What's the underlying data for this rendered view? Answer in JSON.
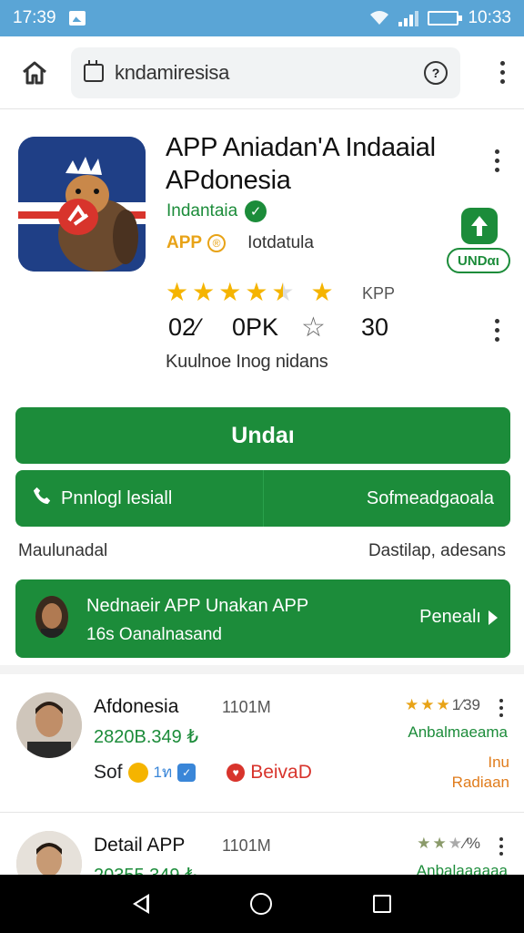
{
  "status_bar": {
    "time_left": "17:39",
    "time_right": "10:33"
  },
  "browser": {
    "url": "kndamiresisa",
    "reload_label": "?"
  },
  "app": {
    "title": "APP Aniadan'A Indaaial APdonesia",
    "developer": "Indantaia",
    "verified_glyph": "✓",
    "badge": "APP",
    "badge_symbol": "®",
    "category": "Iotdatula",
    "update_badge": "UNDαι",
    "rating_stars": 4.5,
    "rating_label": "KPP",
    "stats": [
      "02⁄",
      "0PK",
      "☆",
      "30"
    ],
    "description": "Kuulnoe Inog nidans"
  },
  "buttons": {
    "install_label": "Undaı",
    "left_action_label": "Pnnlogl lesiall",
    "right_action_label": "Sofmeadgaoala",
    "sub_label_left": "Maulunadal",
    "sub_label_right": "Dastilap, adesans"
  },
  "promo": {
    "title": "Nednaeir APP Unakan APP",
    "subtitle": "16s Oanalnasand",
    "action_label": "Penealı"
  },
  "reviews": [
    {
      "name": "Afdonesia",
      "date": "1101M",
      "points": "2820B.349 ₺",
      "rating_text": "1⁄39",
      "tag": "Anbalmaeama",
      "footer_text": "Sof",
      "footer_badge": "1ท",
      "footer_red": "BeivaD",
      "orange_line1": "Inu",
      "orange_line2": "Radiaan"
    },
    {
      "name": "Detail APP",
      "date": "1101M",
      "points": "20355.349 ₺",
      "rating_text": "⁄%",
      "tag": "Anbalaaaaaa"
    }
  ],
  "colors": {
    "status_bar": "#5aa5d6",
    "primary_green": "#1c8c3a",
    "star_yellow": "#f5b400",
    "accent_orange": "#e07c1c",
    "accent_red": "#d8342c"
  }
}
